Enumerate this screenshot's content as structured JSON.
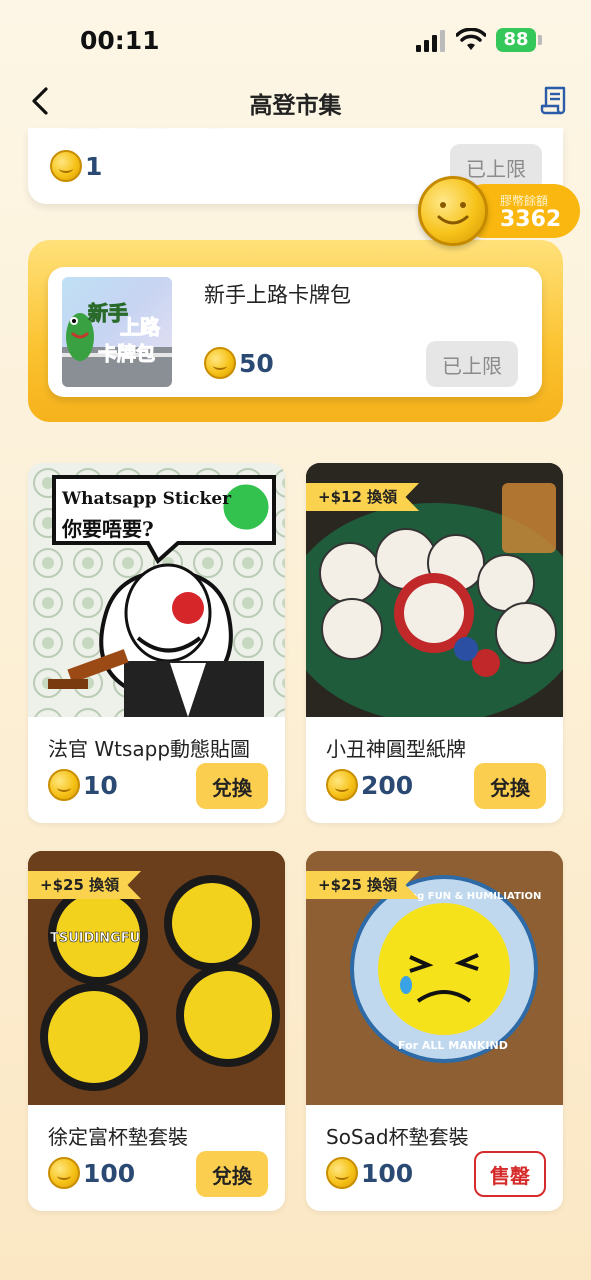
{
  "status_bar": {
    "time": "00:11",
    "battery": "88"
  },
  "nav": {
    "title": "高登市集"
  },
  "top_card": {
    "price": "1",
    "button": "已上限"
  },
  "balance": {
    "label": "膠幣餘額",
    "value": "3362"
  },
  "featured": {
    "title": "新手上路卡牌包",
    "thumb_text": [
      "新手",
      "上路",
      "卡牌包"
    ],
    "price": "50",
    "button": "已上限"
  },
  "products": [
    {
      "title": "法官 Wtsapp動態貼圖",
      "price": "10",
      "button": "兌換",
      "tag": "",
      "img_caption_1": "Whatsapp Sticker",
      "img_caption_2": "你要唔要?"
    },
    {
      "title": "小丑神圓型紙牌",
      "price": "200",
      "button": "兌換",
      "tag": "+$12 換領"
    },
    {
      "title": "徐定富杯墊套裝",
      "price": "100",
      "button": "兌換",
      "tag": "+$25 換領",
      "img_text": "TSUIDINGFU"
    },
    {
      "title": "SoSad杯墊套裝",
      "price": "100",
      "button": "售罄",
      "tag": "+$25 換領",
      "img_text_top": "Creating FUN & HUMILIATION",
      "img_text_bottom": "For ALL MANKIND"
    }
  ],
  "colors": {
    "accent": "#fbce4f",
    "price": "#2a4a73",
    "soldout": "#d52b2b",
    "battery": "#34c759"
  }
}
